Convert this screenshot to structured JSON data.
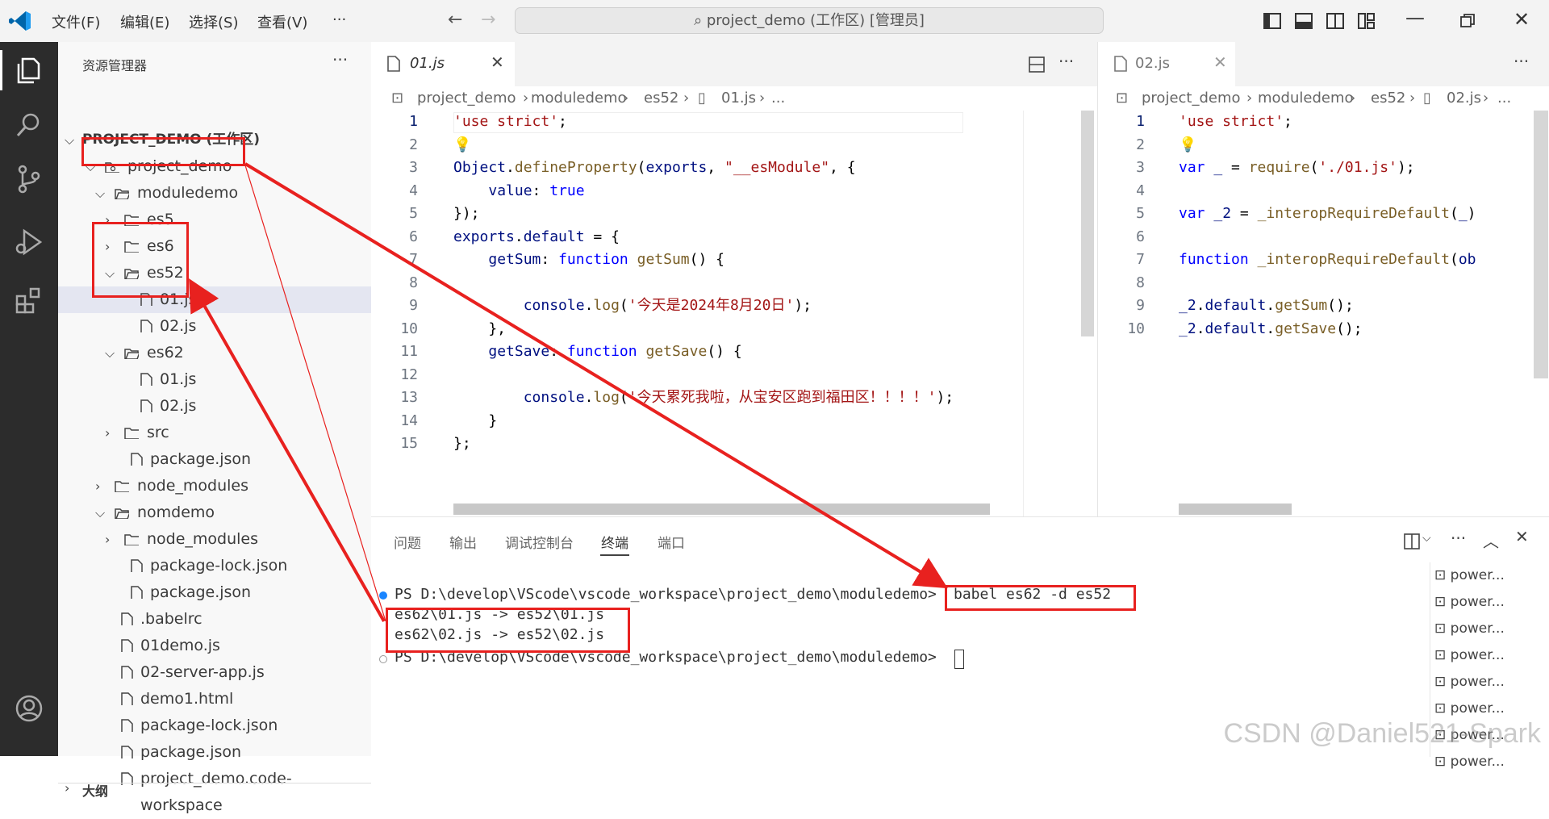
{
  "titlebar": {
    "menus": [
      "文件(F)",
      "编辑(E)",
      "选择(S)",
      "查看(V)",
      "···"
    ],
    "search": "project_demo (工作区) [管理员]"
  },
  "sidebar": {
    "title": "资源管理器",
    "more": "···",
    "workspace": "PROJECT_DEMO (工作区)",
    "tree": [
      {
        "label": "project_demo",
        "depth": 1,
        "type": "root",
        "open": true
      },
      {
        "label": "moduledemo",
        "depth": 2,
        "type": "folder",
        "open": true
      },
      {
        "label": "es5",
        "depth": 3,
        "type": "folder",
        "open": false
      },
      {
        "label": "es6",
        "depth": 3,
        "type": "folder",
        "open": false
      },
      {
        "label": "es52",
        "depth": 3,
        "type": "folder",
        "open": true
      },
      {
        "label": "01.js",
        "depth": 4,
        "type": "file"
      },
      {
        "label": "02.js",
        "depth": 4,
        "type": "file"
      },
      {
        "label": "es62",
        "depth": 3,
        "type": "folder",
        "open": true
      },
      {
        "label": "01.js",
        "depth": 4,
        "type": "file"
      },
      {
        "label": "02.js",
        "depth": 4,
        "type": "file"
      },
      {
        "label": "src",
        "depth": 3,
        "type": "folder",
        "open": false
      },
      {
        "label": "package.json",
        "depth": 3,
        "type": "file"
      },
      {
        "label": "node_modules",
        "depth": 2,
        "type": "folder",
        "open": false
      },
      {
        "label": "nomdemo",
        "depth": 2,
        "type": "folder",
        "open": true
      },
      {
        "label": "node_modules",
        "depth": 3,
        "type": "folder",
        "open": false
      },
      {
        "label": "package-lock.json",
        "depth": 3,
        "type": "file"
      },
      {
        "label": "package.json",
        "depth": 3,
        "type": "file"
      },
      {
        "label": ".babelrc",
        "depth": 2,
        "type": "file"
      },
      {
        "label": "01demo.js",
        "depth": 2,
        "type": "file"
      },
      {
        "label": "02-server-app.js",
        "depth": 2,
        "type": "file"
      },
      {
        "label": "demo1.html",
        "depth": 2,
        "type": "file"
      },
      {
        "label": "package-lock.json",
        "depth": 2,
        "type": "file"
      },
      {
        "label": "package.json",
        "depth": 2,
        "type": "file"
      },
      {
        "label": "project_demo.code-workspace",
        "depth": 2,
        "type": "file"
      }
    ],
    "outline": "大纲"
  },
  "editor1": {
    "tab": "01.js",
    "breadcrumb": [
      "project_demo",
      "moduledemo",
      "es52",
      "01.js",
      "..."
    ],
    "lines": [
      "1",
      "2",
      "3",
      "4",
      "5",
      "6",
      "7",
      "8",
      "9",
      "10",
      "11",
      "12",
      "13",
      "14",
      "15"
    ]
  },
  "editor2": {
    "tab": "02.js",
    "breadcrumb": [
      "project_demo",
      "moduledemo",
      "es52",
      "02.js",
      "..."
    ],
    "lines": [
      "1",
      "2",
      "3",
      "4",
      "5",
      "6",
      "7",
      "8",
      "9",
      "10"
    ]
  },
  "panel": {
    "tabs": [
      "问题",
      "输出",
      "调试控制台",
      "终端",
      "端口"
    ],
    "active_tab": "终端",
    "prompt1": "PS D:\\develop\\VScode\\vscode_workspace\\project_demo\\moduledemo>",
    "command": "babel es62 -d es52",
    "out1": "es62\\01.js -> es52\\01.js",
    "out2": "es62\\02.js -> es52\\02.js",
    "prompt2": "PS D:\\develop\\VScode\\vscode_workspace\\project_demo\\moduledemo>",
    "terminals": [
      "power...",
      "power...",
      "power...",
      "power...",
      "power...",
      "power...",
      "power...",
      "power..."
    ]
  },
  "watermark": "CSDN @Daniel521-Spark",
  "colors": {
    "annotation": "#e8211f",
    "accent": "#007acc"
  }
}
